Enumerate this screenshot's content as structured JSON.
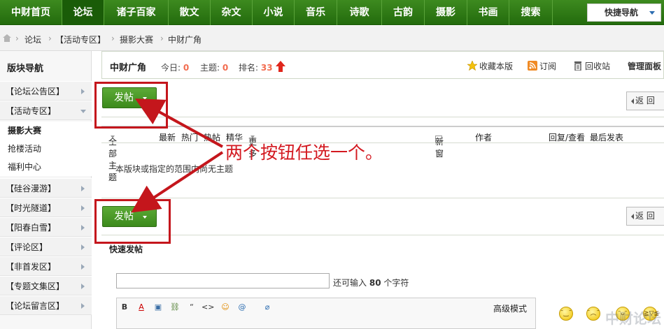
{
  "nav": {
    "items": [
      "中财首页",
      "论坛",
      "诸子百家",
      "散文",
      "杂文",
      "小说",
      "音乐",
      "诗歌",
      "古韵",
      "摄影",
      "书画",
      "搜索"
    ],
    "active_index": 1,
    "quick_nav": "快捷导航"
  },
  "breadcrumb": [
    "论坛",
    "【活动专区】",
    "摄影大赛",
    "中财广角"
  ],
  "sidebar": {
    "title": "版块导航",
    "groups": [
      "【论坛公告区】",
      "【活动专区】"
    ],
    "subs": [
      "摄影大赛",
      "抢楼活动",
      "福利中心"
    ],
    "more_groups": [
      "【硅谷漫游】",
      "【时光隧道】",
      "【阳春白雪】",
      "【评论区】",
      "【非首发区】",
      "【专题文集区】",
      "【论坛留言区】"
    ]
  },
  "board": {
    "name": "中财广角",
    "today_label": "今日:",
    "today": "0",
    "topics_label": "主题:",
    "topics": "0",
    "rank_label": "排名:",
    "rank": "33",
    "favorite": "收藏本版",
    "subscribe": "订阅",
    "recycle": "回收站",
    "manage": "管理面板"
  },
  "buttons": {
    "post": "发帖",
    "back": "返 回"
  },
  "filters": {
    "all": "全部主题",
    "latest": "最新",
    "hot": "热门",
    "hotpost": "热帖",
    "digest": "精华",
    "more": "更多",
    "new_window": "新窗",
    "author": "作者",
    "replies": "回复/查看",
    "last_post": "最后发表"
  },
  "empty_message": "本版块或指定的范围内尚无主题",
  "quick_post": {
    "title": "快速发帖",
    "remain_prefix": "还可输入",
    "remain_count": "80",
    "remain_suffix": "个字符",
    "toolbar": [
      "B",
      "A",
      "▣",
      "⛓",
      "“",
      "<>",
      "☺",
      "@",
      "⌀"
    ],
    "advanced": "高级模式"
  },
  "annotation": "两个按钮任选一个。",
  "watermark": "中财论坛",
  "colors": {
    "nav_green": "#2f7a15",
    "accent_red": "#c4161c",
    "stat_orange": "#f26c4f"
  }
}
